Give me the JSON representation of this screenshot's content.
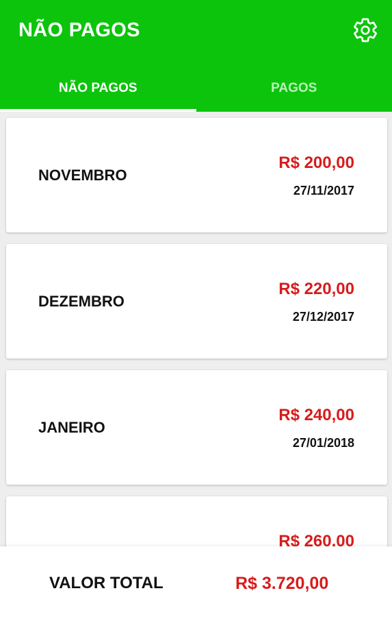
{
  "appbar": {
    "title": "NÃO PAGOS",
    "settings_icon": "gear-icon",
    "color": "#0cc40c"
  },
  "tabs": [
    {
      "label": "NÃO PAGOS",
      "active": true
    },
    {
      "label": "PAGOS",
      "active": false
    }
  ],
  "items": [
    {
      "month": "NOVEMBRO",
      "amount": "R$ 200,00",
      "date": "27/11/2017"
    },
    {
      "month": "DEZEMBRO",
      "amount": "R$ 220,00",
      "date": "27/12/2017"
    },
    {
      "month": "JANEIRO",
      "amount": "R$ 240,00",
      "date": "27/01/2018"
    },
    {
      "month": "",
      "amount": "R$ 260,00",
      "date": ""
    }
  ],
  "footer": {
    "label": "VALOR TOTAL",
    "value": "R$ 3.720,00"
  },
  "colors": {
    "accent_green": "#0cc40c",
    "amount_red": "#d81b1b"
  }
}
